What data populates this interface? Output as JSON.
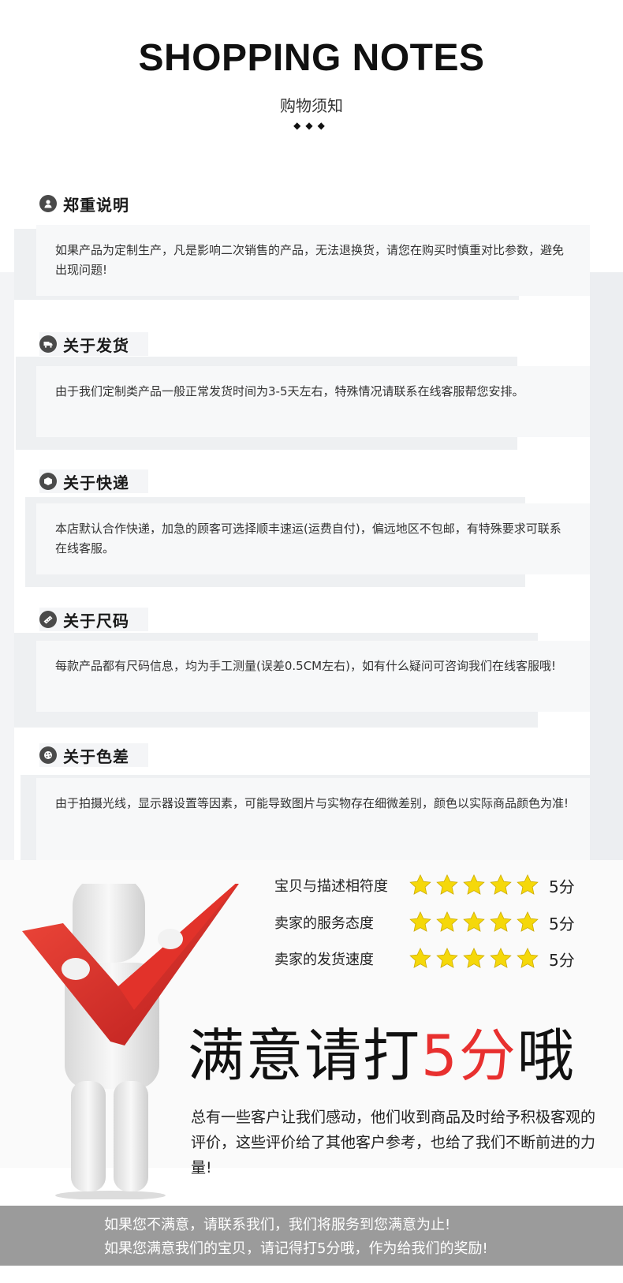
{
  "header": {
    "title": "SHOPPING NOTES",
    "subtitle": "购物须知",
    "ornament": "◆◆◆"
  },
  "notes": [
    {
      "title": "郑重说明",
      "icon": "user-icon",
      "text": "如果产品为定制生产，凡是影响二次销售的产品，无法退换货，请您在购买时慎重对比参数，避免出现问题!"
    },
    {
      "title": "关于发货",
      "icon": "truck-icon",
      "text": "由于我们定制类产品一般正常发货时间为3-5天左右，特殊情况请联系在线客服帮您安排。"
    },
    {
      "title": "关于快递",
      "icon": "package-icon",
      "text": "本店默认合作快递，加急的顾客可选择顺丰速运(运费自付)，偏远地区不包邮，有特殊要求可联系在线客服。"
    },
    {
      "title": "关于尺码",
      "icon": "ruler-icon",
      "text": "每款产品都有尺码信息，均为手工测量(误差0.5CM左右)，如有什么疑问可咨询我们在线客服哦!"
    },
    {
      "title": "关于色差",
      "icon": "palette-icon",
      "text": "由于拍摄光线，显示器设置等因素，可能导致图片与实物存在细微差别，颜色以实际商品颜色为准!"
    }
  ],
  "ratings": [
    {
      "label": "宝贝与描述相符度",
      "stars": 5,
      "score": "5分"
    },
    {
      "label": "卖家的服务态度",
      "stars": 5,
      "score": "5分"
    },
    {
      "label": "卖家的发货速度",
      "stars": 5,
      "score": "5分"
    }
  ],
  "slogan": {
    "prefix": "满意请打",
    "highlight": "5分",
    "suffix": "哦",
    "text": "总有一些客户让我们感动，他们收到商品及时给予积极客观的评价，这些评价给了其他客户参考，也给了我们不断前进的力量!"
  },
  "footer": {
    "line1": "如果您不满意，请联系我们，我们将服务到您满意为止!",
    "line2": "如果您满意我们的宝贝，请记得打5分哦，作为给我们的奖励!"
  },
  "colors": {
    "accent": "#e8302f",
    "star": "#f5d80a",
    "footer_bg": "#9b9b9b"
  }
}
